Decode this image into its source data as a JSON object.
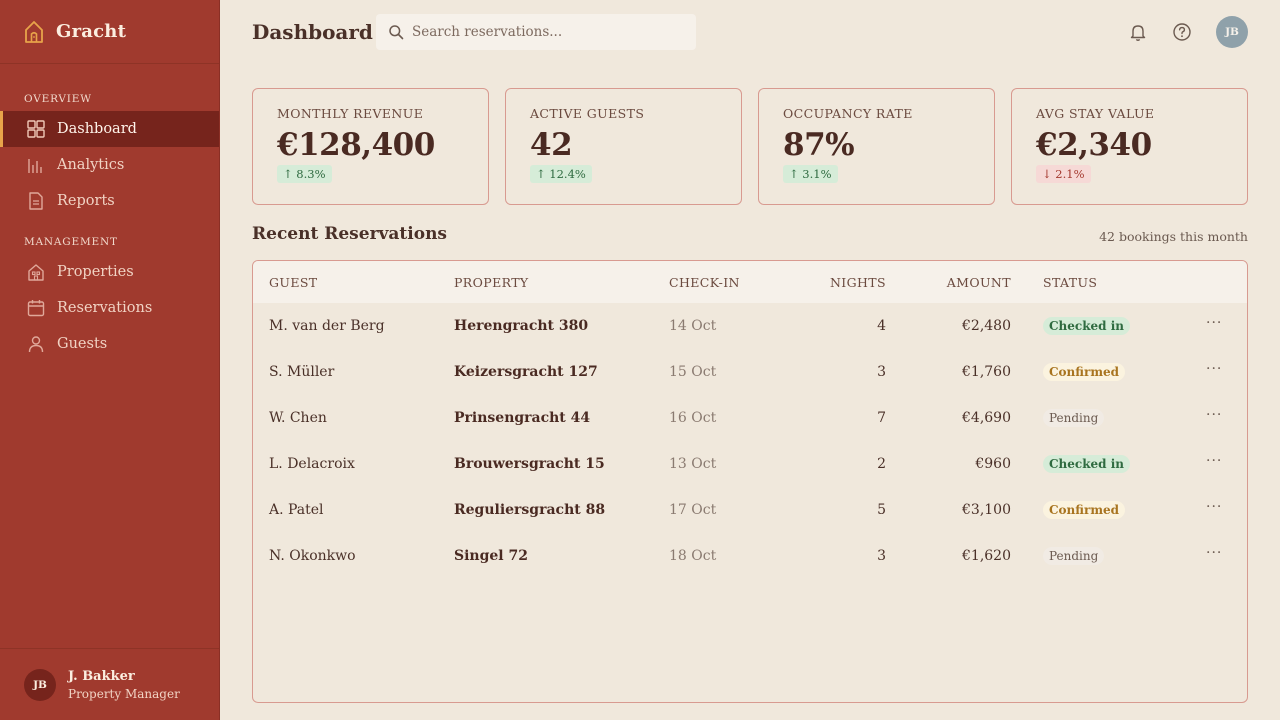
{
  "brand": {
    "name": "Gracht",
    "icon": "house-icon"
  },
  "sidebar": {
    "sections": [
      {
        "label": "OVERVIEW",
        "items": [
          {
            "label": "Dashboard",
            "icon": "grid-icon",
            "active": true
          },
          {
            "label": "Analytics",
            "icon": "bar-chart-icon"
          },
          {
            "label": "Reports",
            "icon": "document-icon"
          }
        ]
      },
      {
        "label": "MANAGEMENT",
        "items": [
          {
            "label": "Properties",
            "icon": "building-icon"
          },
          {
            "label": "Reservations",
            "icon": "calendar-icon"
          },
          {
            "label": "Guests",
            "icon": "user-icon"
          }
        ]
      }
    ],
    "user": {
      "initials": "JB",
      "name": "J. Bakker",
      "role": "Property Manager"
    }
  },
  "header": {
    "title": "Dashboard",
    "search_placeholder": "Search reservations...",
    "avatar_initials": "JB"
  },
  "kpis": [
    {
      "label": "MONTHLY REVENUE",
      "value": "€128,400",
      "change": "↑ 8.3%",
      "direction": "up"
    },
    {
      "label": "ACTIVE GUESTS",
      "value": "42",
      "change": "↑ 12.4%",
      "direction": "up"
    },
    {
      "label": "OCCUPANCY RATE",
      "value": "87%",
      "change": "↑ 3.1%",
      "direction": "up"
    },
    {
      "label": "AVG STAY VALUE",
      "value": "€2,340",
      "change": "↓ 2.1%",
      "direction": "down"
    }
  ],
  "reservations": {
    "title": "Recent Reservations",
    "meta": "42 bookings this month",
    "columns": [
      "GUEST",
      "PROPERTY",
      "CHECK-IN",
      "NIGHTS",
      "AMOUNT",
      "STATUS"
    ],
    "rows": [
      {
        "guest": "M. van der Berg",
        "property": "Herengracht 380",
        "checkin": "14 Oct",
        "nights": "4",
        "amount": "€2,480",
        "status": "Checked in"
      },
      {
        "guest": "S. Müller",
        "property": "Keizersgracht 127",
        "checkin": "15 Oct",
        "nights": "3",
        "amount": "€1,760",
        "status": "Confirmed"
      },
      {
        "guest": "W. Chen",
        "property": "Prinsengracht 44",
        "checkin": "16 Oct",
        "nights": "7",
        "amount": "€4,690",
        "status": "Pending"
      },
      {
        "guest": "L. Delacroix",
        "property": "Brouwersgracht 15",
        "checkin": "13 Oct",
        "nights": "2",
        "amount": "€960",
        "status": "Checked in"
      },
      {
        "guest": "A. Patel",
        "property": "Reguliersgracht 88",
        "checkin": "17 Oct",
        "nights": "5",
        "amount": "€3,100",
        "status": "Confirmed"
      },
      {
        "guest": "N. Okonkwo",
        "property": "Singel 72",
        "checkin": "18 Oct",
        "nights": "3",
        "amount": "€1,620",
        "status": "Pending"
      }
    ],
    "row_action": "···"
  },
  "colors": {
    "sidebar": "#a03a2e",
    "sidebar_active": "#76241c",
    "accent": "#e8a44a",
    "background": "#f0e8dc",
    "status_checked_in": "#2f6b40",
    "status_confirmed": "#a8741f",
    "status_pending": "#6b5a50"
  }
}
